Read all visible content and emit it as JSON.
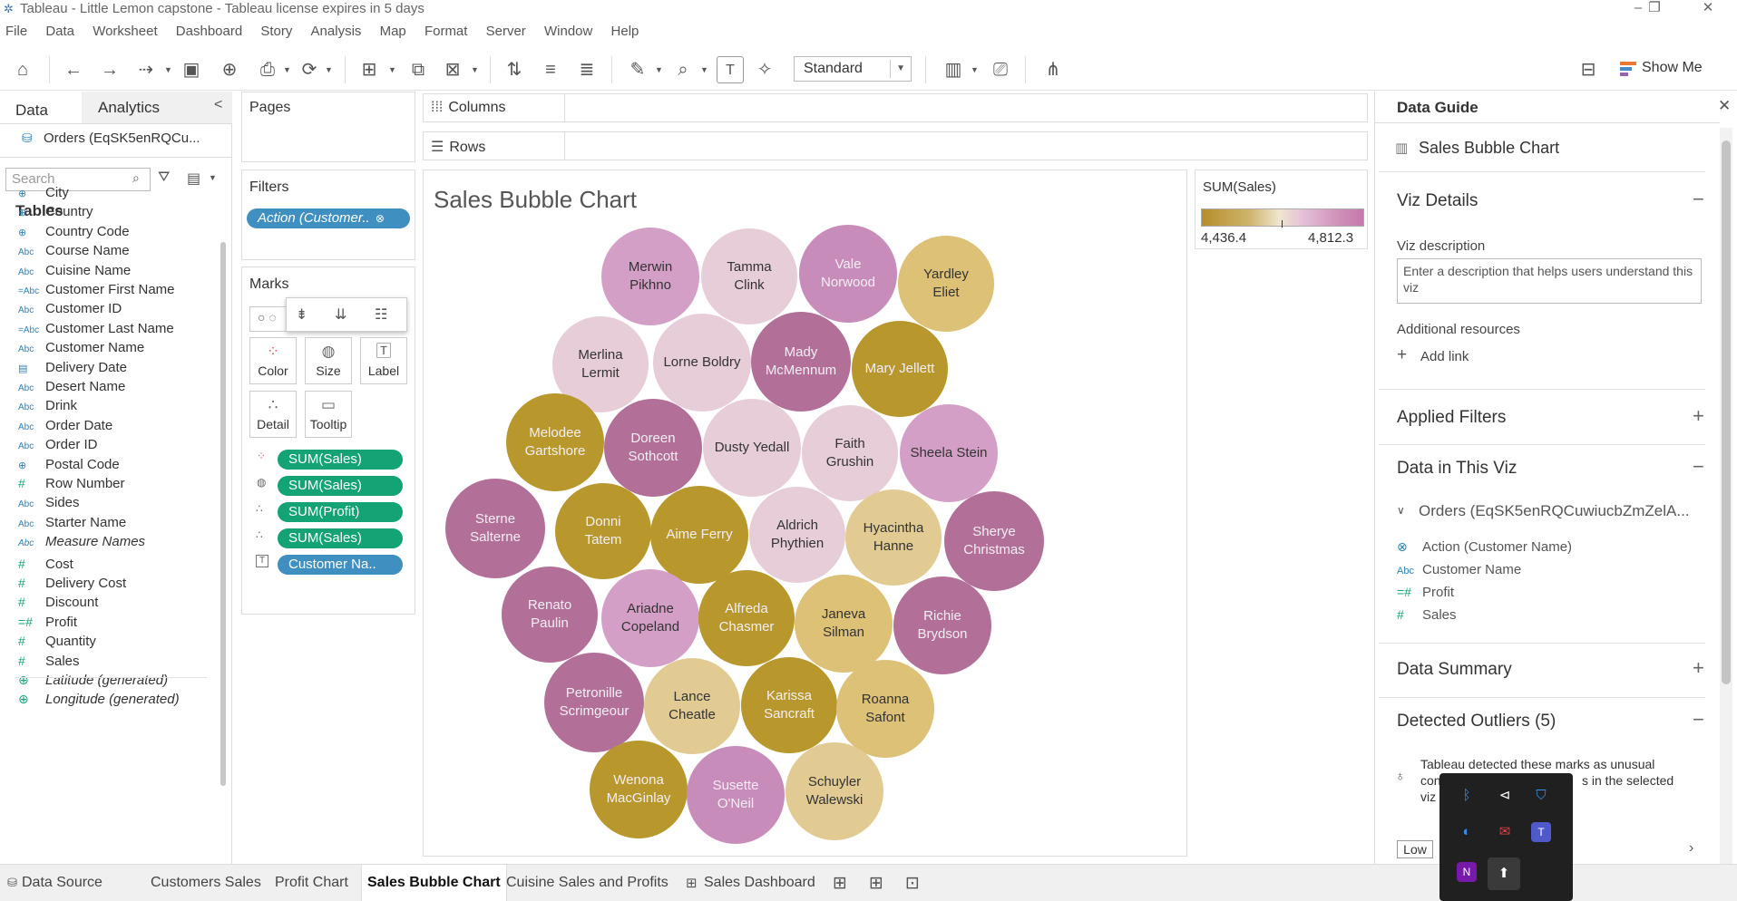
{
  "window": {
    "title": "Tableau - Little Lemon capstone - Tableau license expires in 5 days",
    "controls": [
      "–",
      "❐",
      "✕"
    ]
  },
  "menu": [
    "File",
    "Data",
    "Worksheet",
    "Dashboard",
    "Story",
    "Analysis",
    "Map",
    "Format",
    "Server",
    "Window",
    "Help"
  ],
  "toolbar": {
    "fit": "Standard",
    "show_me": "Show Me"
  },
  "left_pane": {
    "tabs": [
      "Data",
      "Analytics"
    ],
    "collapse": "<",
    "datasource": "Orders (EqSK5enRQCu...",
    "search_placeholder": "Search",
    "tables_heading": "Tables",
    "fields": [
      {
        "icon": "globe",
        "name": "City"
      },
      {
        "icon": "globe",
        "name": "Country"
      },
      {
        "icon": "globe",
        "name": "Country Code"
      },
      {
        "icon": "abc",
        "name": "Course Name"
      },
      {
        "icon": "abc",
        "name": "Cuisine Name"
      },
      {
        "icon": "abc-link",
        "name": "Customer First Name"
      },
      {
        "icon": "abc",
        "name": "Customer ID"
      },
      {
        "icon": "abc-link",
        "name": "Customer Last Name"
      },
      {
        "icon": "abc",
        "name": "Customer Name"
      },
      {
        "icon": "calendar",
        "name": "Delivery Date"
      },
      {
        "icon": "abc",
        "name": "Desert Name"
      },
      {
        "icon": "abc",
        "name": "Drink"
      },
      {
        "icon": "abc",
        "name": "Order Date"
      },
      {
        "icon": "abc",
        "name": "Order ID"
      },
      {
        "icon": "globe",
        "name": "Postal Code"
      },
      {
        "icon": "hash",
        "name": "Row Number"
      },
      {
        "icon": "abc",
        "name": "Sides"
      },
      {
        "icon": "abc",
        "name": "Starter Name"
      },
      {
        "icon": "abc",
        "name": "Measure Names",
        "italic": true
      },
      {
        "icon": "hash",
        "name": "Cost"
      },
      {
        "icon": "hash",
        "name": "Delivery Cost"
      },
      {
        "icon": "hash",
        "name": "Discount"
      },
      {
        "icon": "hash-link",
        "name": "Profit"
      },
      {
        "icon": "hash",
        "name": "Quantity"
      },
      {
        "icon": "hash",
        "name": "Sales"
      },
      {
        "icon": "globe",
        "name": "Latitude (generated)",
        "italic": true
      },
      {
        "icon": "globe",
        "name": "Longitude (generated)",
        "italic": true
      }
    ]
  },
  "cards": {
    "pages": "Pages",
    "filters": "Filters",
    "filter_pill": "Action (Customer..",
    "marks": "Marks",
    "mark_buttons": [
      "Color",
      "Size",
      "Label",
      "Detail",
      "Tooltip"
    ],
    "mark_pills": [
      "SUM(Sales)",
      "SUM(Sales)",
      "SUM(Profit)",
      "SUM(Sales)",
      "Customer Na.."
    ]
  },
  "shelves": {
    "columns": "Columns",
    "rows": "Rows"
  },
  "viz": {
    "title": "Sales Bubble Chart",
    "bubbles": [
      {
        "name": "Merwin\nPikhno",
        "color": "#d49fc7"
      },
      {
        "name": "Tamma\nClink",
        "color": "#e7cdd8"
      },
      {
        "name": "Vale\nNorwood",
        "color": "#c88cbb"
      },
      {
        "name": "Yardley\nEliet",
        "color": "#dcc176"
      },
      {
        "name": "Merlina\nLermit",
        "color": "#e7cdd8"
      },
      {
        "name": "Lorne Boldry",
        "color": "#e7cdd8"
      },
      {
        "name": "Mady\nMcMennum",
        "color": "#b27099"
      },
      {
        "name": "Mary Jellett",
        "color": "#b8972d"
      },
      {
        "name": "Melodee\nGartshore",
        "color": "#b8972d"
      },
      {
        "name": "Doreen\nSothcott",
        "color": "#b27099"
      },
      {
        "name": "Dusty Yedall",
        "color": "#e7cdd8"
      },
      {
        "name": "Faith\nGrushin",
        "color": "#e7cdd8"
      },
      {
        "name": "Sheela Stein",
        "color": "#d49fc7"
      },
      {
        "name": "Sterne\nSalterne",
        "color": "#b27099"
      },
      {
        "name": "Donni\nTatem",
        "color": "#b8972d"
      },
      {
        "name": "Aime Ferry",
        "color": "#b8972d"
      },
      {
        "name": "Aldrich\nPhythien",
        "color": "#e7cdd8"
      },
      {
        "name": "Hyacintha\nHanne",
        "color": "#e2cb93"
      },
      {
        "name": "Sherye\nChristmas",
        "color": "#b27099"
      },
      {
        "name": "Renato\nPaulin",
        "color": "#b27099"
      },
      {
        "name": "Ariadne\nCopeland",
        "color": "#d49fc7"
      },
      {
        "name": "Alfreda\nChasmer",
        "color": "#b8972d"
      },
      {
        "name": "Janeva\nSilman",
        "color": "#dcc176"
      },
      {
        "name": "Richie\nBrydson",
        "color": "#b27099"
      },
      {
        "name": "Petronille\nScrimgeour",
        "color": "#b27099"
      },
      {
        "name": "Lance\nCheatle",
        "color": "#e2cb93"
      },
      {
        "name": "Karissa\nSancraft",
        "color": "#b8972d"
      },
      {
        "name": "Roanna\nSafont",
        "color": "#dcc176"
      },
      {
        "name": "Wenona\nMacGinlay",
        "color": "#b8972d"
      },
      {
        "name": "Susette\nO'Neil",
        "color": "#c88cbb"
      },
      {
        "name": "Schuyler\nWalewski",
        "color": "#e2cb93"
      }
    ]
  },
  "legend": {
    "title": "SUM(Sales)",
    "min": "4,436.4",
    "max": "4,812.3"
  },
  "data_guide": {
    "header": "Data Guide",
    "sheet": "Sales Bubble Chart",
    "viz_details": "Viz Details",
    "viz_description_label": "Viz description",
    "viz_description_placeholder": "Enter a description that helps users understand this viz",
    "additional_resources": "Additional resources",
    "add_link": "Add link",
    "applied_filters": "Applied Filters",
    "data_in_viz": "Data in This Viz",
    "datasource": "Orders (EqSK5enRQCuwiucbZmZelA...",
    "viz_fields": [
      {
        "icon": "link",
        "name": "Action (Customer Name)"
      },
      {
        "icon": "abc",
        "name": "Customer Name"
      },
      {
        "icon": "hash-link",
        "name": "Profit"
      },
      {
        "icon": "hash",
        "name": "Sales"
      }
    ],
    "data_summary": "Data Summary",
    "detected_outliers": "Detected Outliers (5)",
    "outlier_text_1": "Tableau detected these marks as unusual",
    "outlier_text_2": "con",
    "outlier_text_3": "s in the selected",
    "outlier_text_4": "viz",
    "low_button": "Low"
  },
  "bottom_tabs": [
    "Data Source",
    "Customers Sales",
    "Profit Chart",
    "Sales Bubble Chart",
    "Cuisine Sales and Profits",
    "Sales Dashboard"
  ],
  "active_tab": "Sales Bubble Chart"
}
